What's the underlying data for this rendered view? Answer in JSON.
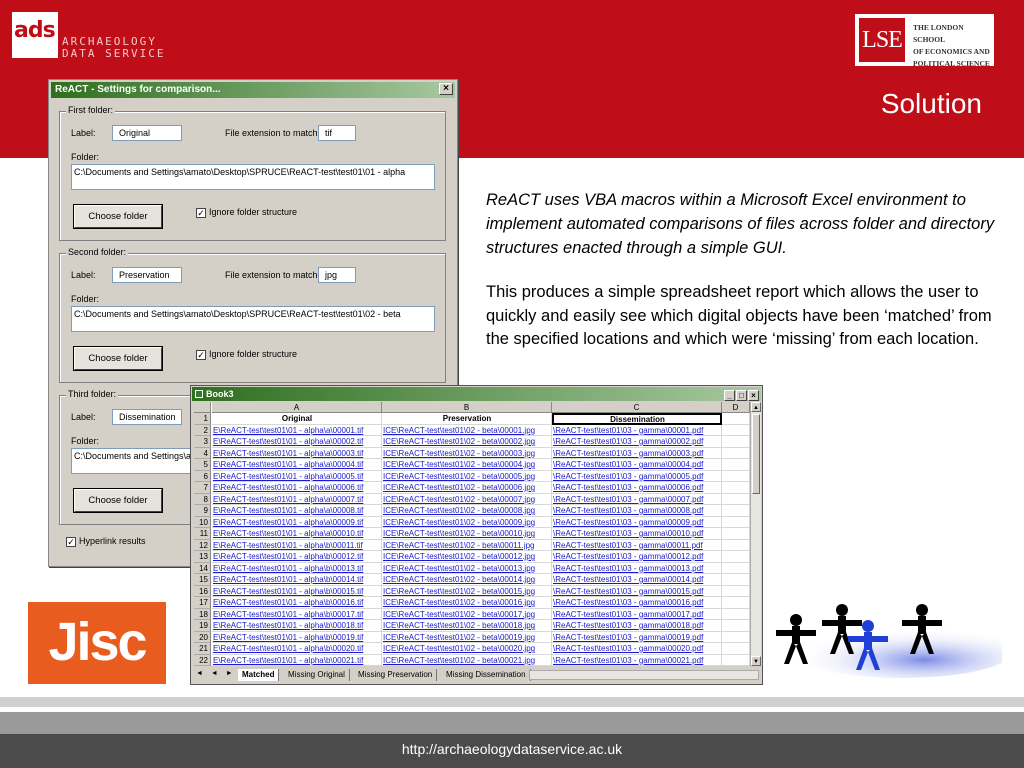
{
  "header": {
    "ads_logo": "ads",
    "ads_text_line1": "ARCHAEOLOGY",
    "ads_text_line2": "DATA SERVICE",
    "lse_logo": "LSE",
    "lse_line1": "THE LONDON SCHOOL",
    "lse_line2": "OF ECONOMICS AND",
    "lse_line3": "POLITICAL SCIENCE",
    "brand_color": "#c00e18"
  },
  "slide": {
    "title": "Solution",
    "para1": "ReACT uses VBA macros within a Microsoft Excel environment to implement automated comparisons of files across folder and directory structures enacted through a simple GUI.",
    "para2": "This produces a simple spreadsheet report which allows the user to quickly and easily see which digital objects have been ‘matched’ from the specified locations and which were ‘missing’ from each location."
  },
  "dialog": {
    "title": "ReACT - Settings for comparison...",
    "close": "×",
    "groups": [
      {
        "title": "First folder:",
        "label_caption": "Label:",
        "label_value": "Original",
        "ext_caption": "File extension to match:",
        "ext_value": "tif",
        "folder_caption": "Folder:",
        "folder_value": "C:\\Documents and Settings\\amato\\Desktop\\SPRUCE\\ReACT-test\\test01\\01 - alpha",
        "button": "Choose folder",
        "ignore": "Ignore folder structure"
      },
      {
        "title": "Second folder:",
        "label_caption": "Label:",
        "label_value": "Preservation",
        "ext_caption": "File extension to match:",
        "ext_value": "jpg",
        "folder_caption": "Folder:",
        "folder_value": "C:\\Documents and Settings\\amato\\Desktop\\SPRUCE\\ReACT-test\\test01\\02 - beta",
        "button": "Choose folder",
        "ignore": "Ignore folder structure"
      },
      {
        "title": "Third folder:",
        "label_caption": "Label:",
        "label_value": "Dissemination",
        "folder_caption": "Folder:",
        "folder_value": "C:\\Documents and Settings\\am",
        "button": "Choose folder"
      }
    ],
    "hyperlink": "Hyperlink results"
  },
  "excel": {
    "title": "Book3",
    "col_letters": [
      "A",
      "B",
      "C",
      "D"
    ],
    "headers": [
      "Original",
      "Preservation",
      "Dissemination"
    ],
    "tabs": [
      "Matched",
      "Missing Original",
      "Missing Preservation",
      "Missing Dissemination"
    ],
    "nav": "◄ ◄ ► ►"
  },
  "footer": {
    "url": "http://archaeologydataservice.ac.uk",
    "jisc": "Jisc"
  }
}
